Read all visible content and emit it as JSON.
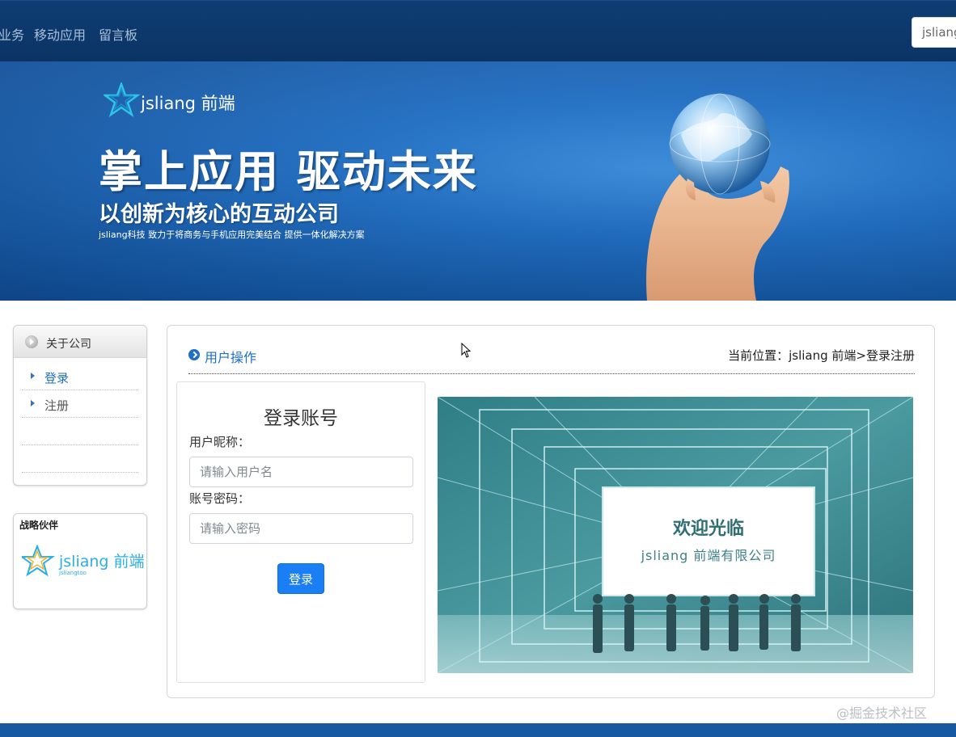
{
  "nav": {
    "items": [
      "业务",
      "移动应用",
      "留言板"
    ],
    "search_value": "jsliang"
  },
  "banner": {
    "logo_text": "jsliang 前端",
    "slogan_main": "掌上应用  驱动未来",
    "slogan_sub": "以创新为核心的互动公司",
    "slogan_small": "jsliang科技  致力于将商务与手机应用完美结合  提供一体化解决方案"
  },
  "sidebar": {
    "about_title": "关于公司",
    "links": [
      {
        "label": "登录",
        "active": true
      },
      {
        "label": "注册",
        "active": false
      }
    ],
    "partner_title": "战略伙伴",
    "partner_logo_text": "jsliang 前端",
    "partner_logo_sub": "jsliangtoo"
  },
  "main": {
    "section_title": "用户操作",
    "location": "当前位置：jsliang 前端>登录注册"
  },
  "login": {
    "title": "登录账号",
    "username_label": "用户昵称：",
    "username_placeholder": "请输入用户名",
    "password_label": "账号密码：",
    "password_placeholder": "请输入密码",
    "submit_label": "登录"
  },
  "welcome": {
    "headline": "欢迎光临",
    "company": "jsliang 前端有限公司"
  },
  "watermark": "@掘金技术社区",
  "colors": {
    "nav_bg": "#0b3465",
    "banner_blue": "#1f6fc6",
    "link_blue": "#1f6fc6",
    "button_blue": "#1a7ef5",
    "teal": "#3c8f95"
  }
}
